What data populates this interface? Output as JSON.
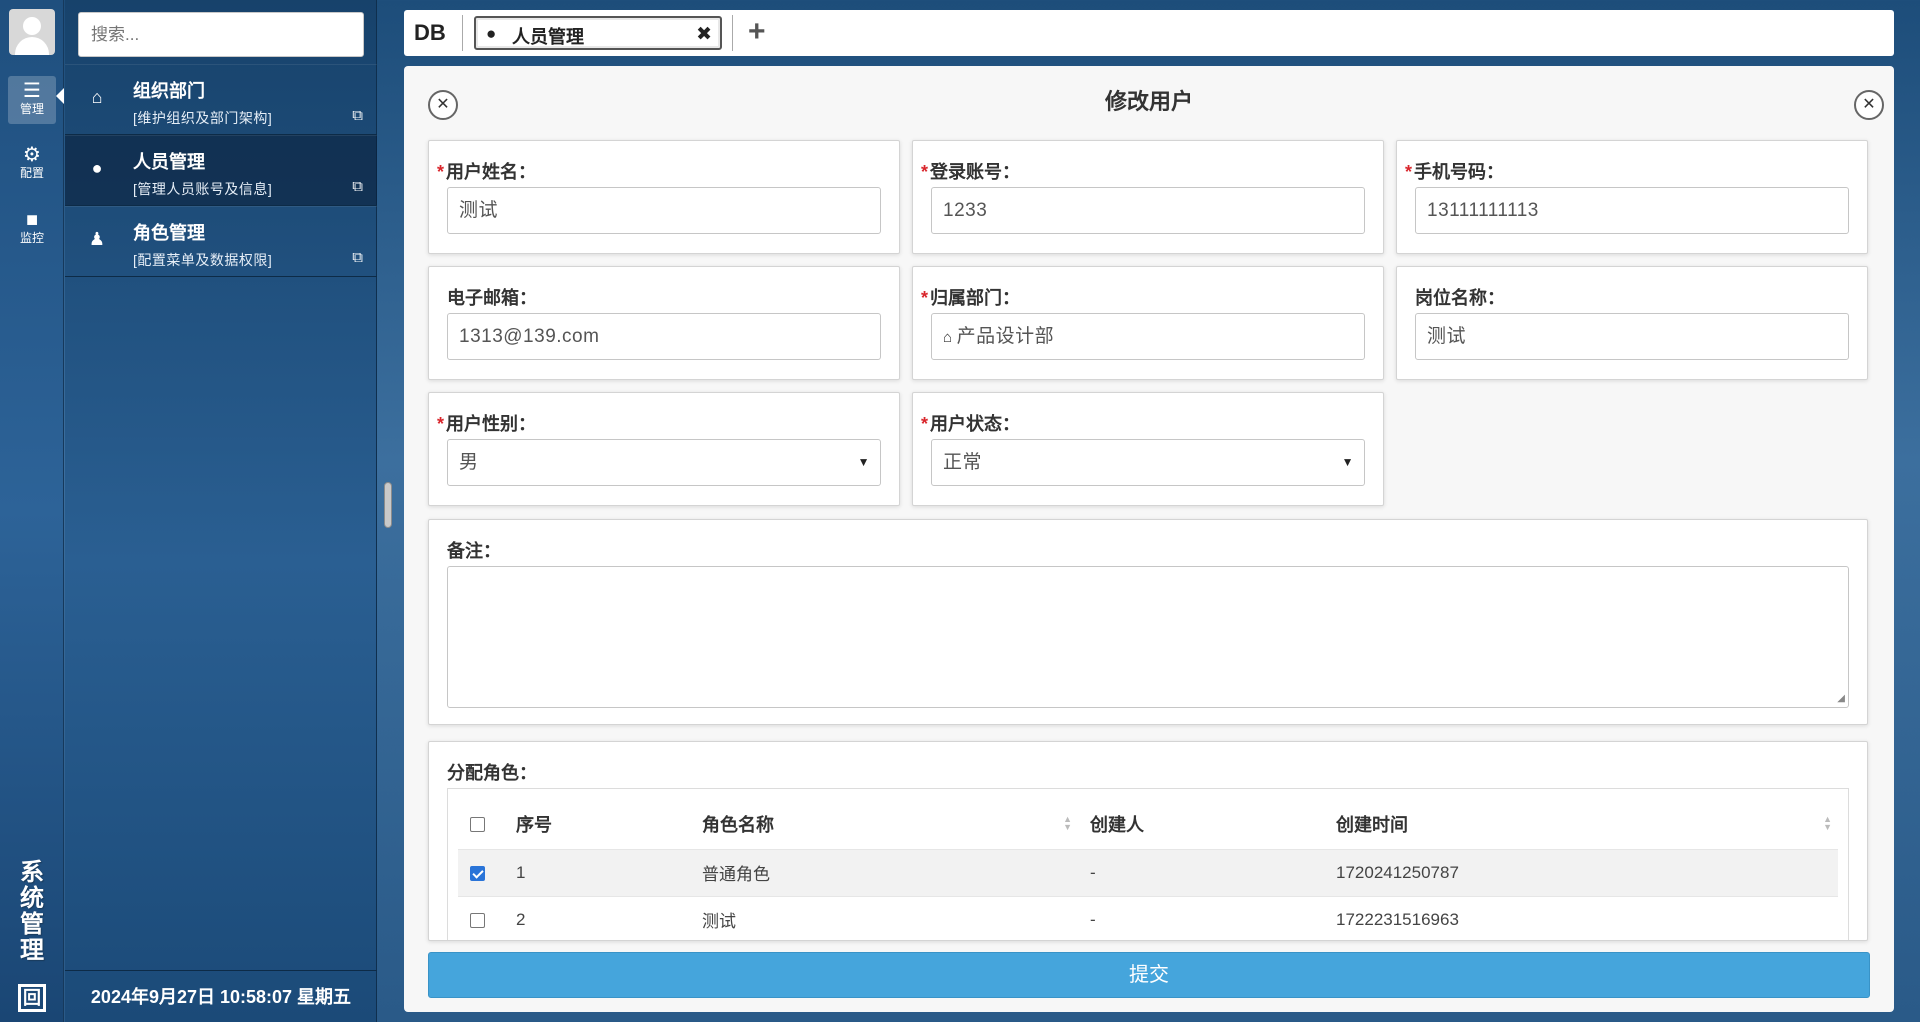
{
  "rail": {
    "items": [
      {
        "label": "管理",
        "icon": "sliders-icon"
      },
      {
        "label": "配置",
        "icon": "gears-icon"
      },
      {
        "label": "监控",
        "icon": "video-camera-icon"
      }
    ],
    "vertical_title": "系统管理",
    "logo": "回"
  },
  "sidebar": {
    "search_placeholder": "搜索...",
    "items": [
      {
        "title": "组织部门",
        "desc": "[维护组织及部门架构]",
        "icon": "sitemap-icon"
      },
      {
        "title": "人员管理",
        "desc": "[管理人员账号及信息]",
        "icon": "users-icon"
      },
      {
        "title": "角色管理",
        "desc": "[配置菜单及数据权限]",
        "icon": "user-secret-icon"
      }
    ],
    "footer_datetime": "2024年9月27日 10:58:07 星期五"
  },
  "tabbar": {
    "brand": "DB",
    "active_tab": "人员管理",
    "add_label": "+"
  },
  "modal": {
    "title": "修改用户",
    "fields": {
      "name": {
        "label": "用户姓名：",
        "value": "测试",
        "required": true
      },
      "account": {
        "label": "登录账号：",
        "value": "1233",
        "required": true
      },
      "phone": {
        "label": "手机号码：",
        "value": "13111111113",
        "required": true
      },
      "email": {
        "label": "电子邮箱：",
        "value": "1313@139.com",
        "required": false
      },
      "dept": {
        "label": "归属部门：",
        "value": "产品设计部",
        "required": true
      },
      "position": {
        "label": "岗位名称：",
        "value": "测试",
        "required": false
      },
      "gender": {
        "label": "用户性别：",
        "value": "男",
        "required": true
      },
      "status": {
        "label": "用户状态：",
        "value": "正常",
        "required": true
      },
      "remark": {
        "label": "备注：",
        "value": ""
      }
    },
    "roles": {
      "label": "分配角色：",
      "columns": [
        "序号",
        "角色名称",
        "创建人",
        "创建时间"
      ],
      "rows": [
        {
          "checked": true,
          "no": "1",
          "name": "普通角色",
          "creator": "-",
          "created": "1720241250787"
        },
        {
          "checked": false,
          "no": "2",
          "name": "测试",
          "creator": "-",
          "created": "1722231516963"
        }
      ]
    },
    "submit_label": "提交"
  },
  "colors": {
    "primary": "#45a5dc",
    "required": "#d9262c",
    "sidebar_bg": "#1f4f7e"
  }
}
